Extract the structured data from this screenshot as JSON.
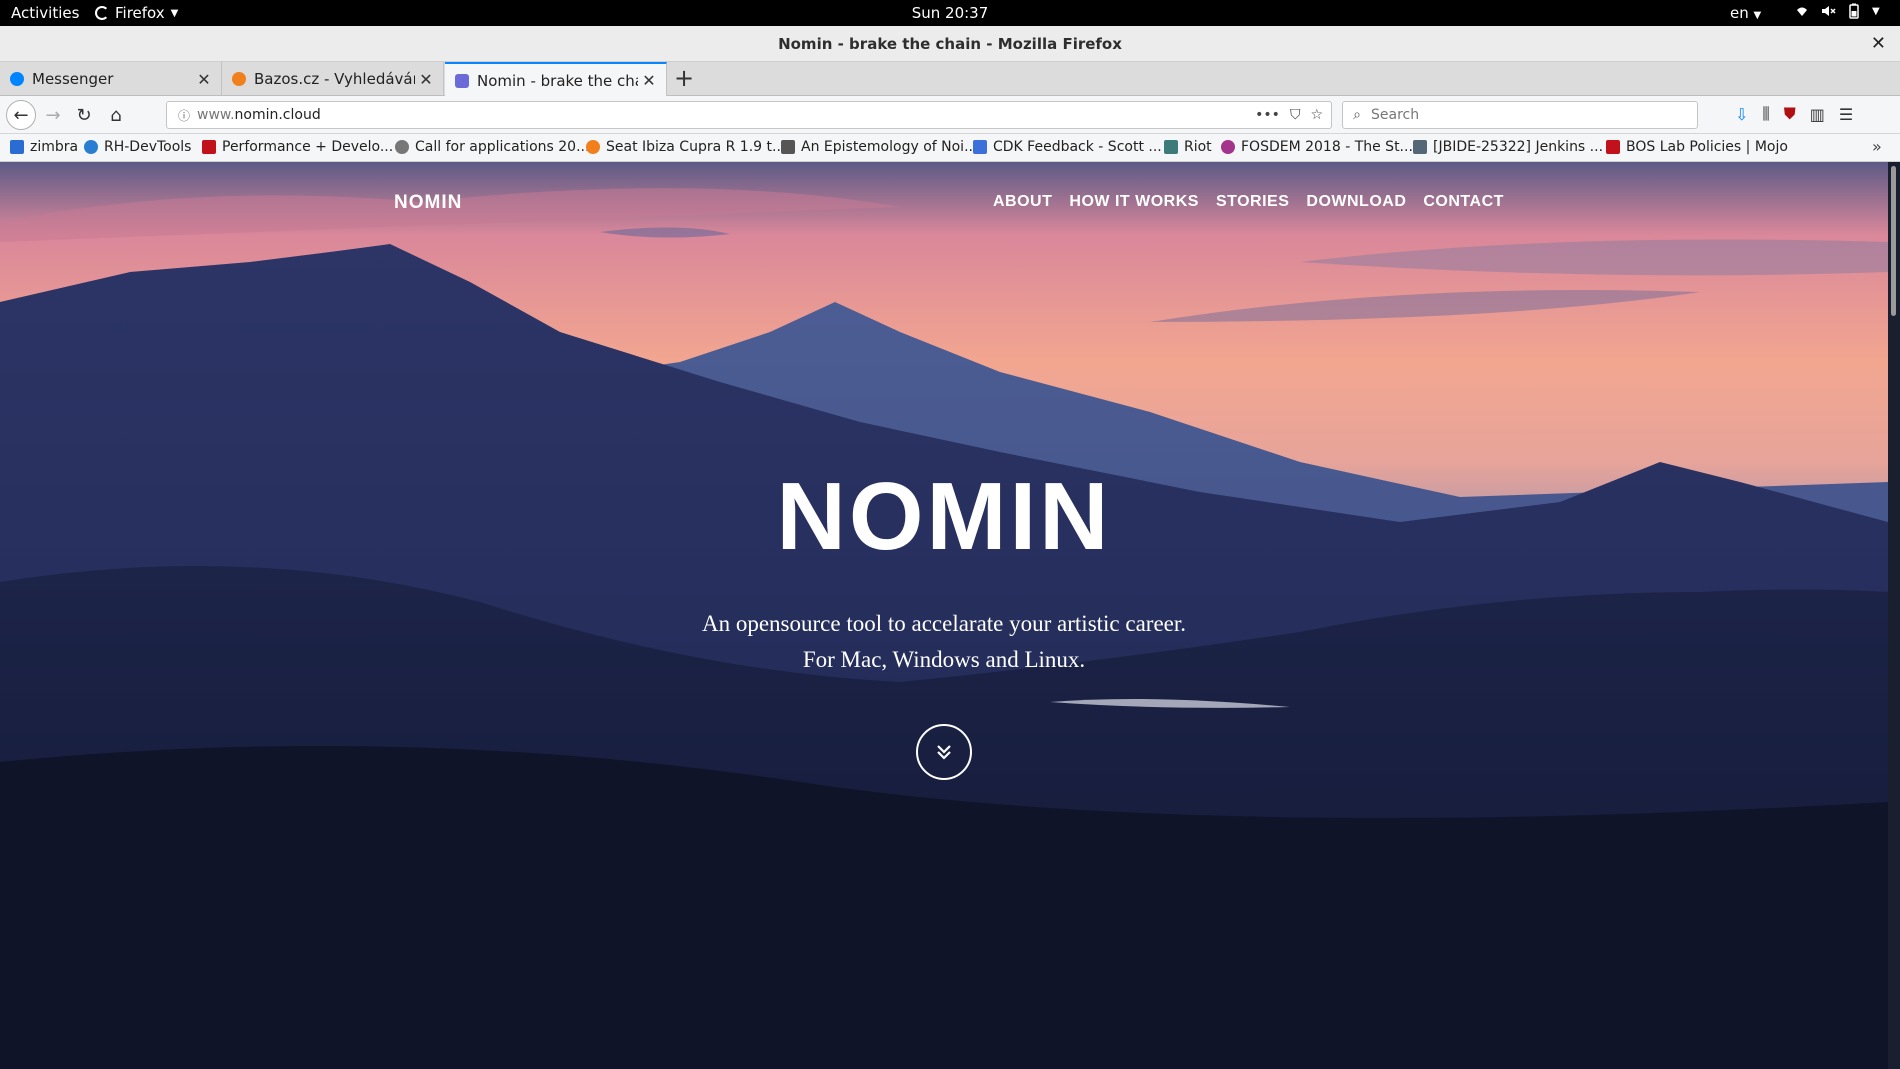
{
  "topbar": {
    "activities": "Activities",
    "app": "Firefox",
    "clock": "Sun 20:37",
    "lang": "en"
  },
  "window": {
    "title": "Nomin - brake the chain - Mozilla Firefox"
  },
  "tabs": [
    {
      "label": "Messenger",
      "icon": "messenger-icon",
      "color": "#0084ff"
    },
    {
      "label": "Bazos.cz - Vyhledávání",
      "icon": "bazos-icon",
      "color": "#f07f1c"
    },
    {
      "label": "Nomin - brake the chain",
      "icon": "nomin-icon",
      "color": "#6a6ad8",
      "active": true
    }
  ],
  "toolbar": {
    "url_prefix": "www.",
    "url_domain": "nomin.cloud",
    "search_placeholder": "Search"
  },
  "bookmarks": [
    {
      "label": "zimbra",
      "color": "#2a6cd2"
    },
    {
      "label": "RH-DevTools",
      "color": "#2a7ed2"
    },
    {
      "label": "Performance + Develo...",
      "color": "#c1121c"
    },
    {
      "label": "Call for applications 20...",
      "color": "#777777"
    },
    {
      "label": "Seat Ibiza Cupra R 1.9 t...",
      "color": "#f07f1c"
    },
    {
      "label": "An Epistemology of Noi...",
      "color": "#555555"
    },
    {
      "label": "CDK Feedback - Scott ...",
      "color": "#3b6fd9"
    },
    {
      "label": "Riot",
      "color": "#3d7a7a"
    },
    {
      "label": "FOSDEM 2018 - The St...",
      "color": "#a4348b"
    },
    {
      "label": "[JBIDE-25322] Jenkins ...",
      "color": "#556677"
    },
    {
      "label": "BOS Lab Policies | Mojo",
      "color": "#c1121c"
    }
  ],
  "site": {
    "brand": "NOMIN",
    "nav": [
      "ABOUT",
      "HOW IT WORKS",
      "STORIES",
      "DOWNLOAD",
      "CONTACT"
    ],
    "hero_title": "NOMIN",
    "hero_line1": "An opensource tool to accelarate your artistic career.",
    "hero_line2": "For Mac, Windows and Linux."
  }
}
